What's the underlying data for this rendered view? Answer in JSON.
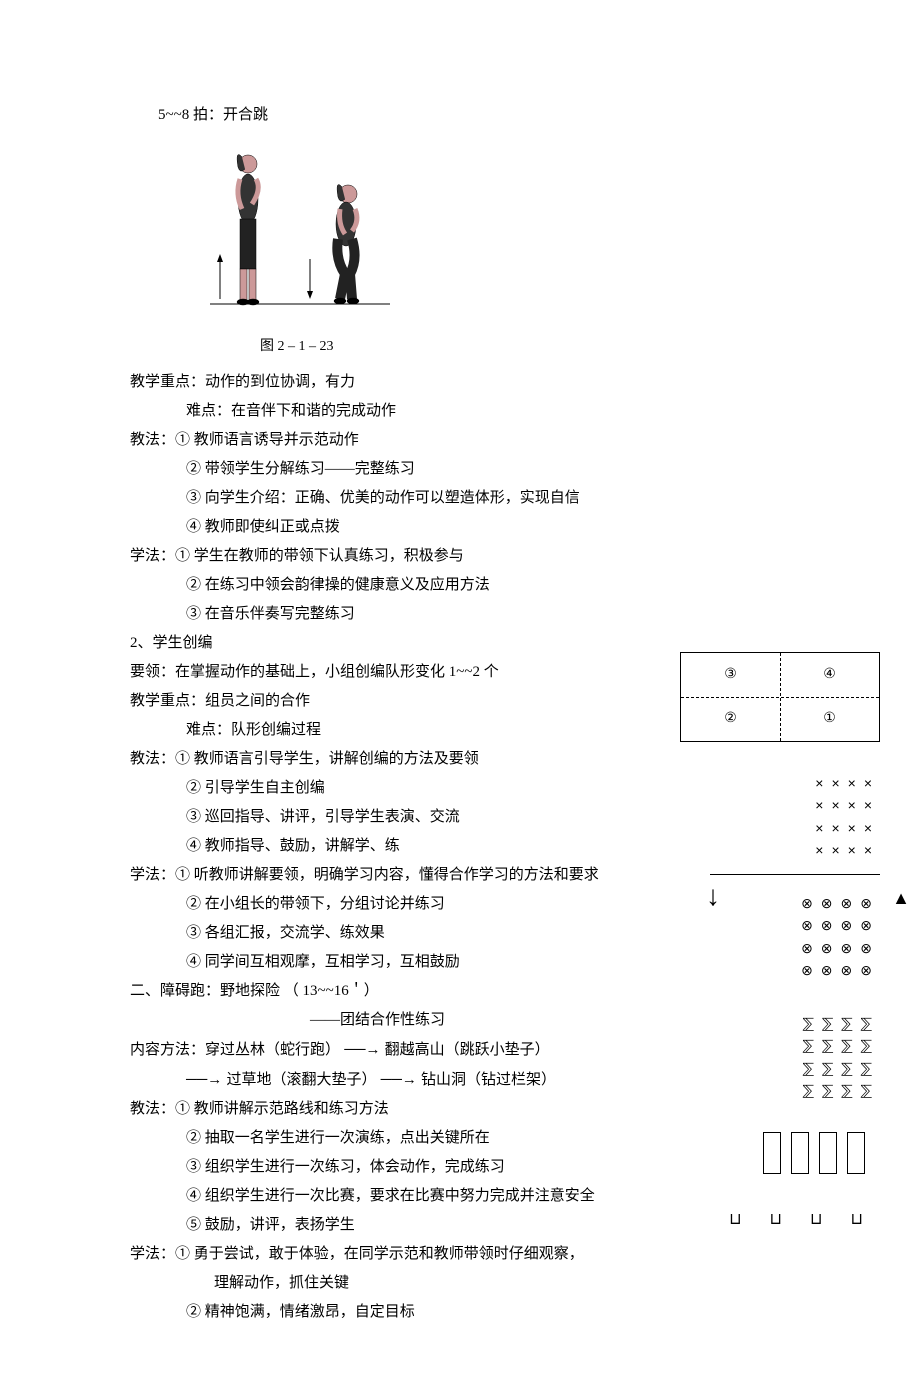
{
  "header": {
    "beat_line": "5~~8 拍：开合跳"
  },
  "figure": {
    "caption": "图 2 – 1 – 23"
  },
  "section1": {
    "focus_label": "教学重点：",
    "focus_text": "动作的到位协调，有力",
    "difficulty_label": "难点：",
    "difficulty_text": "在音伴下和谐的完成动作",
    "teach_label": "教法：",
    "teach_items": [
      "① 教师语言诱导并示范动作",
      "② 带领学生分解练习——完整练习",
      "③ 向学生介绍：正确、优美的动作可以塑造体形，实现自信",
      "④ 教师即使纠正或点拨"
    ],
    "learn_label": "学法：",
    "learn_items": [
      "① 学生在教师的带领下认真练习，积极参与",
      "② 在练习中领会韵律操的健康意义及应用方法",
      "③ 在音乐伴奏写完整练习"
    ]
  },
  "section2": {
    "title": "2、学生创编",
    "yaoling_label": "要领：",
    "yaoling_text": "在掌握动作的基础上，小组创编队形变化 1~~2 个",
    "focus_label": "教学重点：",
    "focus_text": "组员之间的合作",
    "difficulty_label": "难点：",
    "difficulty_text": "队形创编过程",
    "teach_label": "教法：",
    "teach_items": [
      "① 教师语言引导学生，讲解创编的方法及要领",
      "② 引导学生自主创编",
      "③ 巡回指导、讲评，引导学生表演、交流",
      "④ 教师指导、鼓励，讲解学、练"
    ],
    "learn_label": "学法：",
    "learn_items": [
      "① 听教师讲解要领，明确学习内容，懂得合作学习的方法和要求",
      "② 在小组长的带领下，分组讨论并练习",
      "③ 各组汇报，交流学、练效果",
      "④ 同学间互相观摩，互相学习，互相鼓励"
    ]
  },
  "section3": {
    "title": "二、障碍跑：野地探险 （ 13~~16＇）",
    "subtitle": "——团结合作性练习",
    "content_label": "内容方法：",
    "content_line1_a": "穿过丛林（蛇行跑）",
    "content_line1_b": "翻越高山（跳跃小垫子）",
    "content_line2_a": "过草地（滚翻大垫子）",
    "content_line2_b": "钻山洞（钻过栏架）",
    "arrow": "→",
    "teach_label": "教法：",
    "teach_items": [
      "① 教师讲解示范路线和练习方法",
      "② 抽取一名学生进行一次演练，点出关键所在",
      "③ 组织学生进行一次练习，体会动作，完成练习",
      "④ 组织学生进行一次比赛，要求在比赛中努力完成并注意安全",
      "⑤ 鼓励，讲评，表扬学生"
    ],
    "learn_label": "学法：",
    "learn_items": [
      "① 勇于尝试，敢于体验，在同学示范和教师带领时仔细观察，",
      "理解动作，抓住关键",
      "② 精神饱满，情绪激昂，自定目标"
    ]
  },
  "quad": {
    "c1": "①",
    "c2": "②",
    "c3": "③",
    "c4": "④"
  },
  "symbols": {
    "x_row": "××××",
    "o_row": "⊗⊗⊗⊗",
    "d_row": "⅀⅀⅀⅀",
    "u_row": "⊔ ⊔ ⊔ ⊔",
    "triangle": "▲",
    "arrow_down": "↓"
  }
}
